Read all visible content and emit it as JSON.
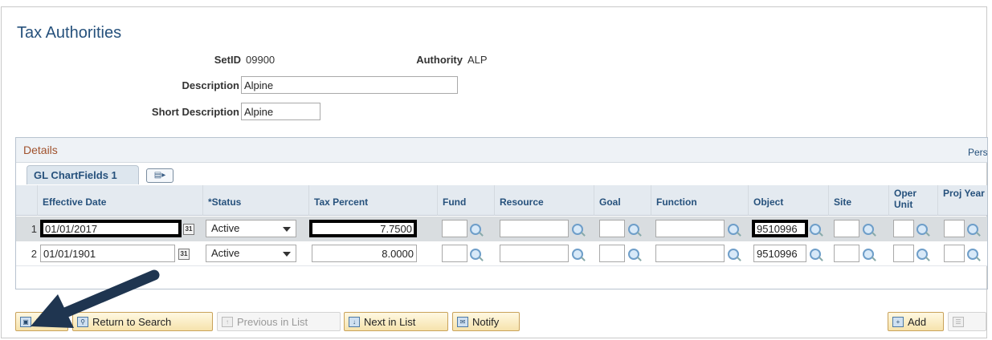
{
  "page_title": "Tax Authorities",
  "header": {
    "setid_label": "SetID",
    "setid_value": "09900",
    "authority_label": "Authority",
    "authority_value": "ALP",
    "description_label": "Description",
    "description_value": "Alpine",
    "short_description_label": "Short Description",
    "short_description_value": "Alpine"
  },
  "details": {
    "title": "Details",
    "personalize_link": "Pers",
    "tab_label": "GL ChartFields 1",
    "columns": {
      "effective_date": "Effective Date",
      "status": "*Status",
      "tax_percent": "Tax Percent",
      "fund": "Fund",
      "resource": "Resource",
      "goal": "Goal",
      "function": "Function",
      "object": "Object",
      "site": "Site",
      "oper_unit": "Oper Unit",
      "proj_year": "Proj Year"
    },
    "rows": [
      {
        "num": "1",
        "effective_date": "01/01/2017",
        "status": "Active",
        "tax_percent": "7.7500",
        "object": "9510996"
      },
      {
        "num": "2",
        "effective_date": "01/01/1901",
        "status": "Active",
        "tax_percent": "8.0000",
        "object": "9510996"
      }
    ]
  },
  "toolbar": {
    "save": "Save",
    "return_to_search": "Return to Search",
    "previous_in_list": "Previous in List",
    "next_in_list": "Next in List",
    "notify": "Notify",
    "add": "Add"
  },
  "colors": {
    "title_blue": "#26517c",
    "details_orange": "#a0522d",
    "button_gold": "#f6e3ac",
    "highlight_black": "#000000",
    "arrow_navy": "#1f3550"
  }
}
